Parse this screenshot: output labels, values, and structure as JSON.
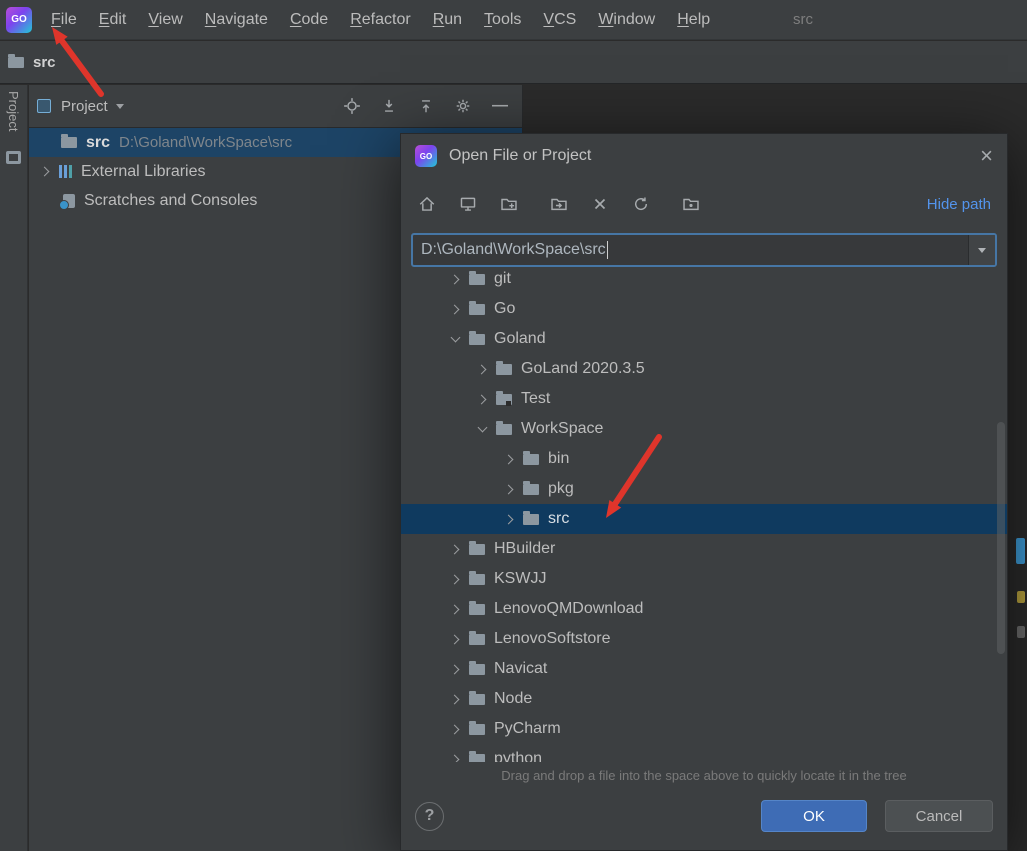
{
  "branding": {
    "logo_text": "GO"
  },
  "menubar": {
    "items": [
      "File",
      "Edit",
      "View",
      "Navigate",
      "Code",
      "Refactor",
      "Run",
      "Tools",
      "VCS",
      "Window",
      "Help"
    ],
    "window_title": "src"
  },
  "navbar": {
    "crumb": "src"
  },
  "tool_stripe": {
    "tab_label": "Project"
  },
  "project_panel": {
    "title": "Project",
    "root_name": "src",
    "root_path": "D:\\Goland\\WorkSpace\\src",
    "items": [
      {
        "label": "External Libraries"
      },
      {
        "label": "Scratches and Consoles"
      }
    ]
  },
  "dialog": {
    "title": "Open File or Project",
    "hide_path_label": "Hide path",
    "path_value": "D:\\Goland\\WorkSpace\\src",
    "hint": "Drag and drop a file into the space above to quickly locate it in the tree",
    "help_label": "?",
    "ok_label": "OK",
    "cancel_label": "Cancel",
    "tree": [
      {
        "label": "git",
        "level": 1,
        "state": "collapsed"
      },
      {
        "label": "Go",
        "level": 1,
        "state": "collapsed"
      },
      {
        "label": "Goland",
        "level": 1,
        "state": "expanded"
      },
      {
        "label": "GoLand 2020.3.5",
        "level": 2,
        "state": "collapsed"
      },
      {
        "label": "Test",
        "level": 2,
        "state": "collapsed"
      },
      {
        "label": "WorkSpace",
        "level": 2,
        "state": "expanded"
      },
      {
        "label": "bin",
        "level": 3,
        "state": "collapsed"
      },
      {
        "label": "pkg",
        "level": 3,
        "state": "collapsed"
      },
      {
        "label": "src",
        "level": 3,
        "state": "collapsed",
        "selected": true
      },
      {
        "label": "HBuilder",
        "level": 1,
        "state": "collapsed"
      },
      {
        "label": "KSWJJ",
        "level": 1,
        "state": "collapsed"
      },
      {
        "label": "LenovoQMDownload",
        "level": 1,
        "state": "collapsed"
      },
      {
        "label": "LenovoSoftstore",
        "level": 1,
        "state": "collapsed"
      },
      {
        "label": "Navicat",
        "level": 1,
        "state": "collapsed"
      },
      {
        "label": "Node",
        "level": 1,
        "state": "collapsed"
      },
      {
        "label": "PyCharm",
        "level": 1,
        "state": "collapsed"
      },
      {
        "label": "python",
        "level": 1,
        "state": "collapsed"
      }
    ]
  },
  "icons": {
    "close": "×",
    "minimize_panel": "—"
  },
  "colors": {
    "panel_bg": "#3c3f41",
    "editor_bg": "#2b2b2b",
    "accent_link": "#5394ec",
    "dialog_selection": "#0f3a5f",
    "project_selection": "#1d4466",
    "ok_button": "#3e6cb5",
    "annotation_arrow": "#df352b"
  }
}
